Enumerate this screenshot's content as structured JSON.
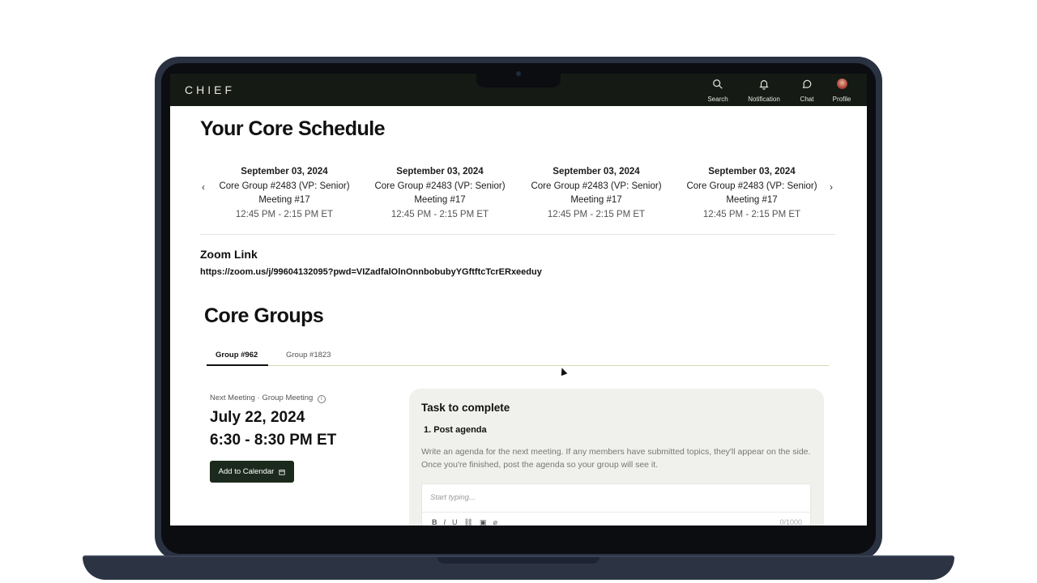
{
  "app": {
    "logo": "CHIEF",
    "nav": [
      {
        "label": "Search",
        "icon": "search-icon"
      },
      {
        "label": "Notification",
        "icon": "bell-icon"
      },
      {
        "label": "Chat",
        "icon": "chat-icon"
      },
      {
        "label": "Profile",
        "icon": "avatar"
      }
    ]
  },
  "schedule": {
    "title": "Your Core Schedule",
    "prev_arrow": "‹",
    "next_arrow": "›",
    "cards": [
      {
        "date": "September 03, 2024",
        "group": "Core Group #2483 (VP: Senior)",
        "meeting": "Meeting #17",
        "time": "12:45 PM - 2:15 PM ET"
      },
      {
        "date": "September 03, 2024",
        "group": "Core Group #2483 (VP: Senior)",
        "meeting": "Meeting #17",
        "time": "12:45 PM - 2:15 PM ET"
      },
      {
        "date": "September 03, 2024",
        "group": "Core Group #2483 (VP: Senior)",
        "meeting": "Meeting #17",
        "time": "12:45 PM - 2:15 PM ET"
      },
      {
        "date": "September 03, 2024",
        "group": "Core Group #2483 (VP: Senior)",
        "meeting": "Meeting #17",
        "time": "12:45 PM - 2:15 PM ET"
      }
    ],
    "zoom_title": "Zoom Link",
    "zoom_url": "https://zoom.us/j/99604132095?pwd=VIZadfalOlnOnnbobubyYGftftcTcrERxeeduy"
  },
  "core_groups": {
    "title": "Core Groups",
    "tabs": [
      {
        "label": "Group #962",
        "active": true
      },
      {
        "label": "Group #1823",
        "active": false
      }
    ],
    "next_meeting_label": "Next Meeting",
    "meeting_type": "Group Meeting",
    "date": "July 22, 2024",
    "time": "6:30 - 8:30 PM ET",
    "add_calendar": "Add to Calendar"
  },
  "task": {
    "title": "Task to complete",
    "step": "1. Post agenda",
    "description": "Write an agenda for the next meeting. If any members have submitted topics, they'll appear on the side. Once you're finished, post the agenda so your group will see it.",
    "placeholder": "Start typing...",
    "toolbar": [
      "B",
      "I",
      "U",
      "link",
      "image",
      "attach"
    ],
    "counter": "0/1000"
  },
  "colors": {
    "topbar": "#151a14",
    "button": "#1b2a1c",
    "tab_line": "#d4dbb4"
  }
}
